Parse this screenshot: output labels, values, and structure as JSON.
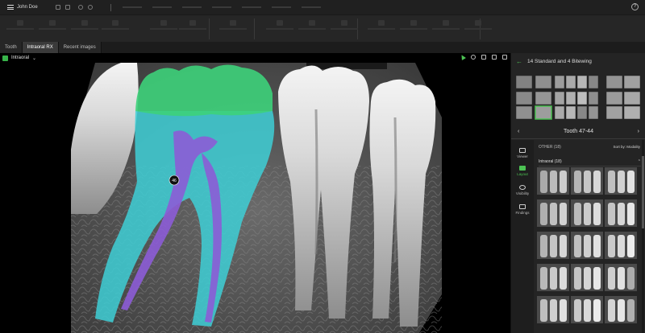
{
  "topbar": {
    "user": "John Doe",
    "icons": [
      "menu-icon",
      "undo-icon",
      "redo-icon",
      "camera-icon",
      "settings-icon",
      "more-icon",
      "help-icon"
    ],
    "help_glyph": "?"
  },
  "tabs": [
    {
      "label": "Tooth",
      "active": false
    },
    {
      "label": "Intraoral RX",
      "active": true
    },
    {
      "label": "Recent images",
      "active": false
    }
  ],
  "viewer": {
    "modality_label": "Intraoral",
    "marker_label": "46"
  },
  "panel": {
    "header_title": "14 Standard and 4 Bitewing",
    "nav_title": "Tooth 47-44",
    "prev_glyph": "‹",
    "next_glyph": "›",
    "sidenav": [
      {
        "label": "Viewer",
        "active": false
      },
      {
        "label": "Layout",
        "active": true
      },
      {
        "label": "Visibility",
        "active": false
      },
      {
        "label": "Findings",
        "active": false
      }
    ],
    "other_label": "OTHER (18)",
    "sort_label": "Sort by: Modality",
    "intraoral_label": "Intraoral (18)"
  },
  "colors": {
    "accent": "#4cc253",
    "crown_overlay": "#3dd17a",
    "root_overlay": "#3ecfd6",
    "canal_overlay": "#8c5cd6"
  }
}
